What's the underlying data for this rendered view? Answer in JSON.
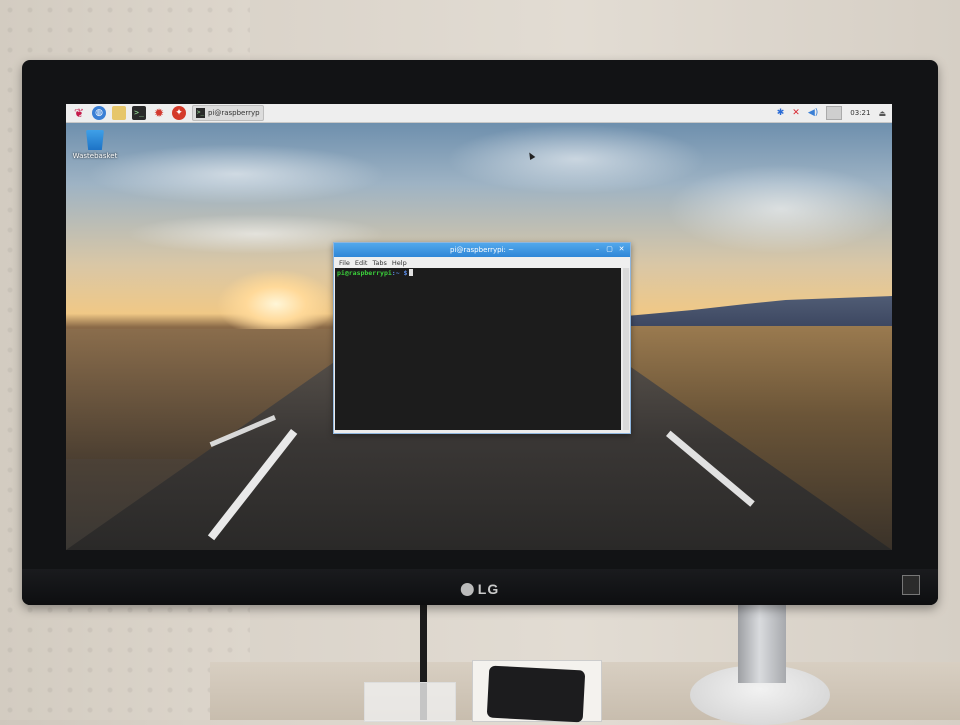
{
  "monitor": {
    "brand": "LG"
  },
  "taskbar": {
    "launchers": [
      {
        "name": "menu-icon"
      },
      {
        "name": "browser-icon"
      },
      {
        "name": "file-manager-icon"
      },
      {
        "name": "terminal-icon"
      },
      {
        "name": "mathematica-icon"
      },
      {
        "name": "wolfram-icon"
      }
    ],
    "window_button": {
      "label": "pi@raspberrypi: ~"
    },
    "tray": {
      "bluetooth_icon": "bluetooth-icon",
      "network_icon": "network-disconnected-icon",
      "volume_icon": "volume-icon",
      "clock": "03:21"
    }
  },
  "desktop": {
    "icons": [
      {
        "label": "Wastebasket"
      }
    ]
  },
  "terminal": {
    "title": "pi@raspberrypi: ~",
    "menu": [
      "File",
      "Edit",
      "Tabs",
      "Help"
    ],
    "prompt": {
      "user_host": "pi@raspberrypi",
      "path": ":~ $"
    }
  },
  "colors": {
    "titlebar": "#2f86d7",
    "terminal_bg": "#1c1c1c",
    "prompt_green": "#3bd13b",
    "prompt_blue": "#5b8de8"
  }
}
